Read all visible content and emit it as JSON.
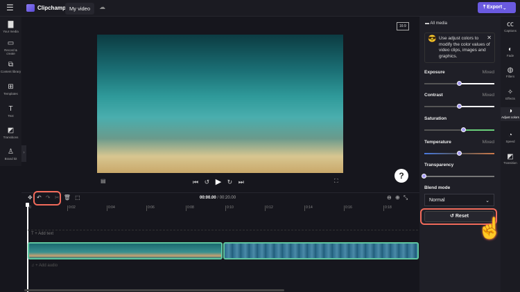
{
  "header": {
    "app_name": "Clipchamp",
    "project_title": "My video",
    "export_label": "Export"
  },
  "sidebar": {
    "items": [
      {
        "label": "Your media",
        "icon": "folder-icon"
      },
      {
        "label": "Record & create",
        "icon": "camera-icon"
      },
      {
        "label": "Content library",
        "icon": "library-icon"
      },
      {
        "label": "Templates",
        "icon": "templates-icon"
      },
      {
        "label": "Text",
        "icon": "text-icon"
      },
      {
        "label": "Transitions",
        "icon": "transitions-icon"
      },
      {
        "label": "Brand kit",
        "icon": "brand-icon"
      }
    ]
  },
  "preview": {
    "aspect_ratio": "16:9",
    "help": "?"
  },
  "timeline": {
    "current_time": "00:00.00",
    "total_time": "/ 00:20.00",
    "ticks": [
      "0",
      "0:02",
      "0:04",
      "0:06",
      "0:08",
      "0:10",
      "0:12",
      "0:14",
      "0:16",
      "0:18"
    ],
    "add_text": "+ Add text",
    "add_audio": "+ Add audio"
  },
  "panel": {
    "header": "All media",
    "tip": "Use adjust colors to modify the color values of video clips, images and graphics.",
    "sliders": [
      {
        "label": "Exposure",
        "status": "Mixed",
        "value": 0.5
      },
      {
        "label": "Contrast",
        "status": "Mixed",
        "value": 0.5
      },
      {
        "label": "Saturation",
        "status": "",
        "value": 0.56
      },
      {
        "label": "Temperature",
        "status": "Mixed",
        "value": 0.5
      },
      {
        "label": "Transparency",
        "status": "",
        "value": 0
      }
    ],
    "blend_label": "Blend mode",
    "blend_value": "Normal",
    "reset_label": "Reset"
  },
  "right_tabs": [
    {
      "label": "Captions"
    },
    {
      "label": "Fade"
    },
    {
      "label": "Filters"
    },
    {
      "label": "Effects"
    },
    {
      "label": "Adjust colors"
    },
    {
      "label": "Speed"
    },
    {
      "label": "Transition"
    }
  ]
}
